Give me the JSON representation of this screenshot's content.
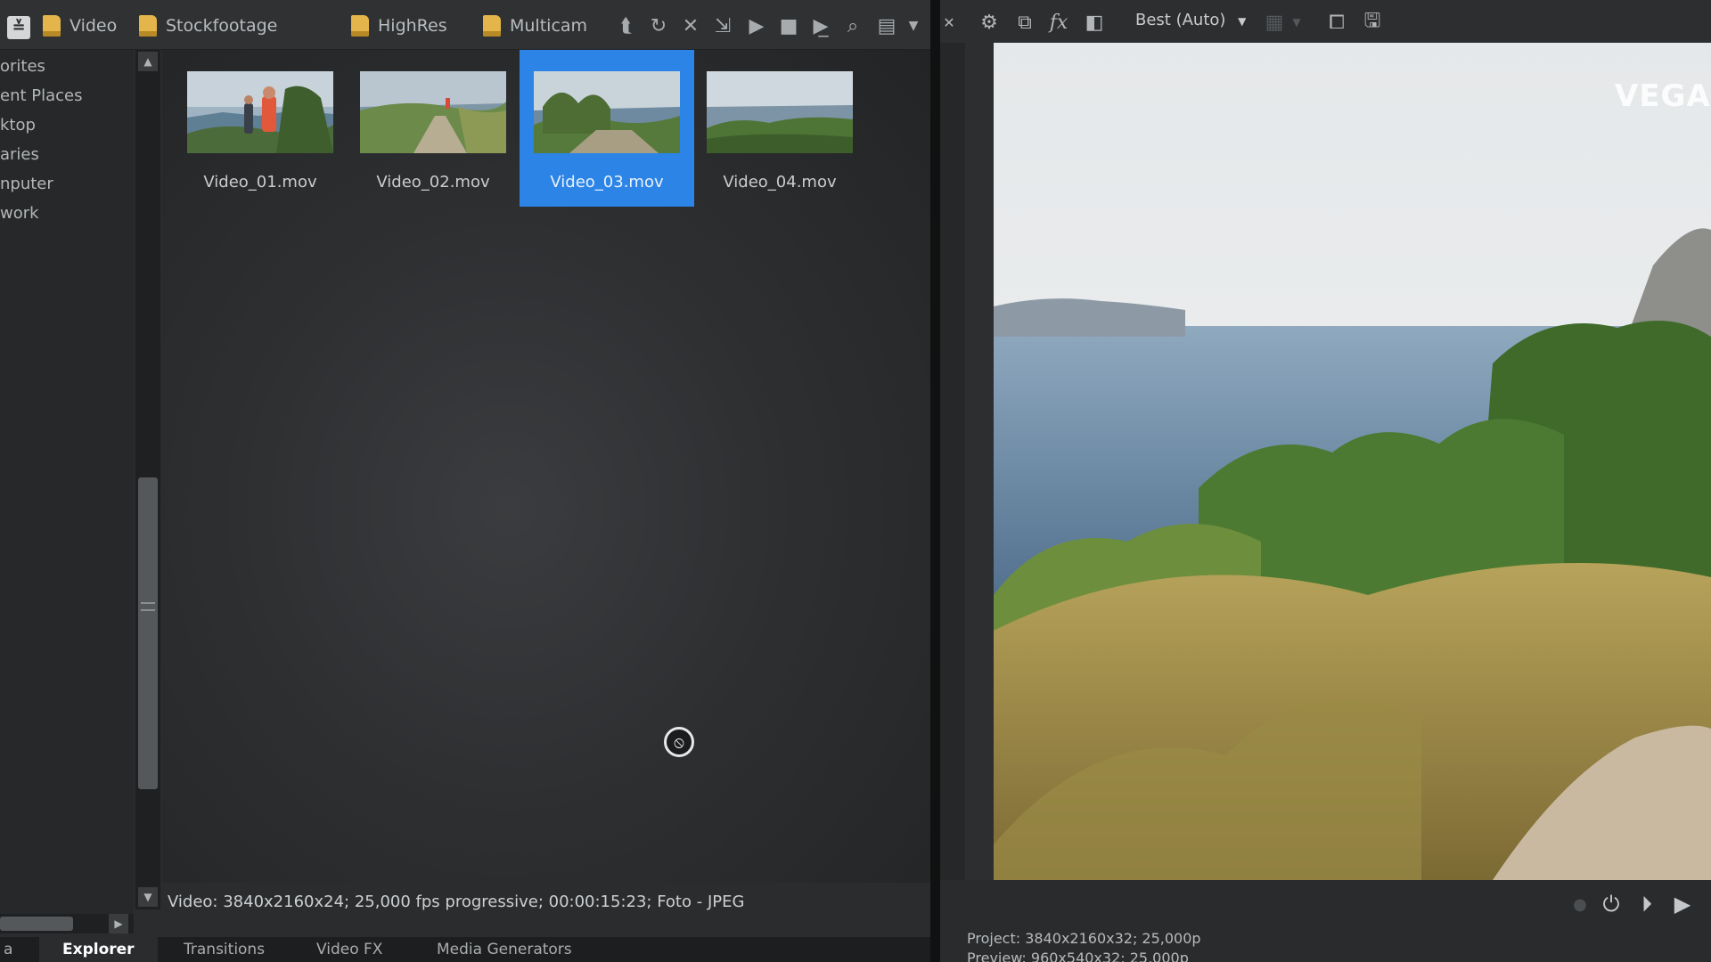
{
  "explorer": {
    "toolbar": {
      "folders": [
        "Video",
        "Stockfootage",
        "HighRes",
        "Multicam"
      ]
    },
    "tree": {
      "items": [
        "orites",
        "ent Places",
        "ktop",
        "aries",
        "nputer",
        "work"
      ]
    },
    "clips": [
      {
        "name": "Video_01.mov",
        "selected": false
      },
      {
        "name": "Video_02.mov",
        "selected": false
      },
      {
        "name": "Video_03.mov",
        "selected": true
      },
      {
        "name": "Video_04.mov",
        "selected": false
      }
    ],
    "status": "Video: 3840x2160x24; 25,000 fps progressive; 00:00:15:23; Foto - JPEG"
  },
  "tabs": [
    {
      "label": "a",
      "active": false
    },
    {
      "label": "Explorer",
      "active": true
    },
    {
      "label": "Transitions",
      "active": false
    },
    {
      "label": "Video FX",
      "active": false
    },
    {
      "label": "Media Generators",
      "active": false
    }
  ],
  "preview": {
    "quality": "Best (Auto)",
    "watermark": "VEGAS",
    "project_info": "Project:  3840x2160x32; 25,000p",
    "preview_info": "Preview:  960x540x32; 25,000p"
  },
  "colors": {
    "selection": "#2b84e6",
    "folder": "#e3b54a",
    "background": "#2a2c2e"
  }
}
